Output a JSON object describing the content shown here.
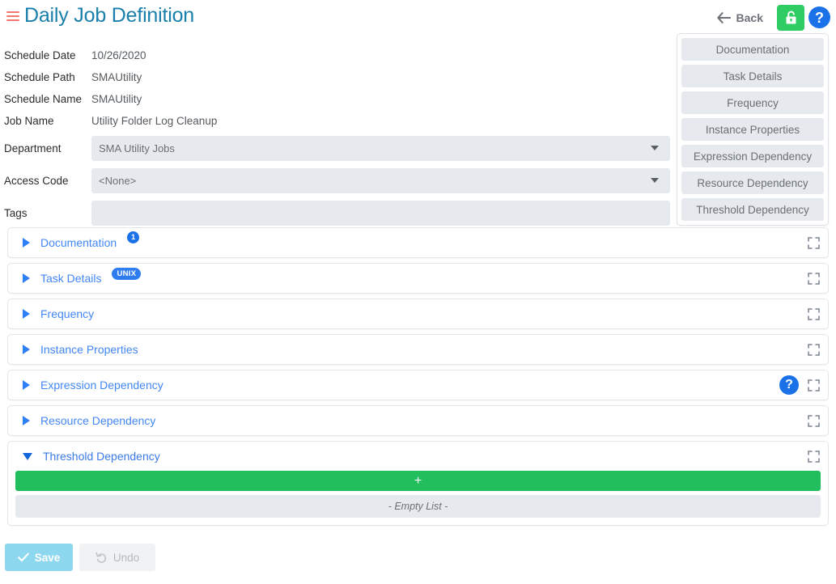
{
  "header": {
    "menu_icon": "hamburger-icon",
    "title": "Daily Job Definition",
    "back_label": "Back",
    "lock_icon": "unlocked-padlock-icon",
    "help_icon": "question-mark-icon",
    "accent_color": "#1a7fab",
    "menu_color": "#f2766b",
    "lock_bg_color": "#2ecc62",
    "help_bg_color": "#1b72e8"
  },
  "fields": [
    {
      "label": "Schedule Date",
      "value": "10/26/2020",
      "type": "readonly"
    },
    {
      "label": "Schedule Path",
      "value": "SMAUtility",
      "type": "readonly"
    },
    {
      "label": "Schedule Name",
      "value": "SMAUtility",
      "type": "readonly"
    },
    {
      "label": "Job Name",
      "value": "Utility Folder Log Cleanup",
      "type": "readonly"
    },
    {
      "label": "Department",
      "value": "SMA Utility Jobs",
      "type": "dropdown-search"
    },
    {
      "label": "Access Code",
      "value": "<None>",
      "type": "dropdown-search"
    },
    {
      "label": "Tags",
      "value": "",
      "type": "text"
    }
  ],
  "nav_panel": {
    "items": [
      {
        "label": "Documentation"
      },
      {
        "label": "Task Details"
      },
      {
        "label": "Frequency"
      },
      {
        "label": "Instance Properties"
      },
      {
        "label": "Expression Dependency"
      },
      {
        "label": "Resource Dependency"
      },
      {
        "label": "Threshold Dependency"
      }
    ]
  },
  "accordion": {
    "sections": [
      {
        "title": "Documentation",
        "expanded": false,
        "badge_num": "1",
        "badge_pill": null,
        "help": false
      },
      {
        "title": "Task Details",
        "expanded": false,
        "badge_num": null,
        "badge_pill": "UNIX",
        "help": false
      },
      {
        "title": "Frequency",
        "expanded": false,
        "badge_num": null,
        "badge_pill": null,
        "help": false
      },
      {
        "title": "Instance Properties",
        "expanded": false,
        "badge_num": null,
        "badge_pill": null,
        "help": false
      },
      {
        "title": "Expression Dependency",
        "expanded": false,
        "badge_num": null,
        "badge_pill": null,
        "help": true
      },
      {
        "title": "Resource Dependency",
        "expanded": false,
        "badge_num": null,
        "badge_pill": null,
        "help": false
      },
      {
        "title": "Threshold Dependency",
        "expanded": true,
        "badge_num": null,
        "badge_pill": null,
        "help": false
      }
    ],
    "threshold_body": {
      "add_label": "+",
      "empty_label": "- Empty List -",
      "add_color": "#22bd5c"
    }
  },
  "footer": {
    "save_label": "Save",
    "save_icon": "checkmark-icon",
    "save_disabled": true,
    "undo_label": "Undo",
    "undo_icon": "undo-arrow-icon",
    "undo_disabled": true
  }
}
